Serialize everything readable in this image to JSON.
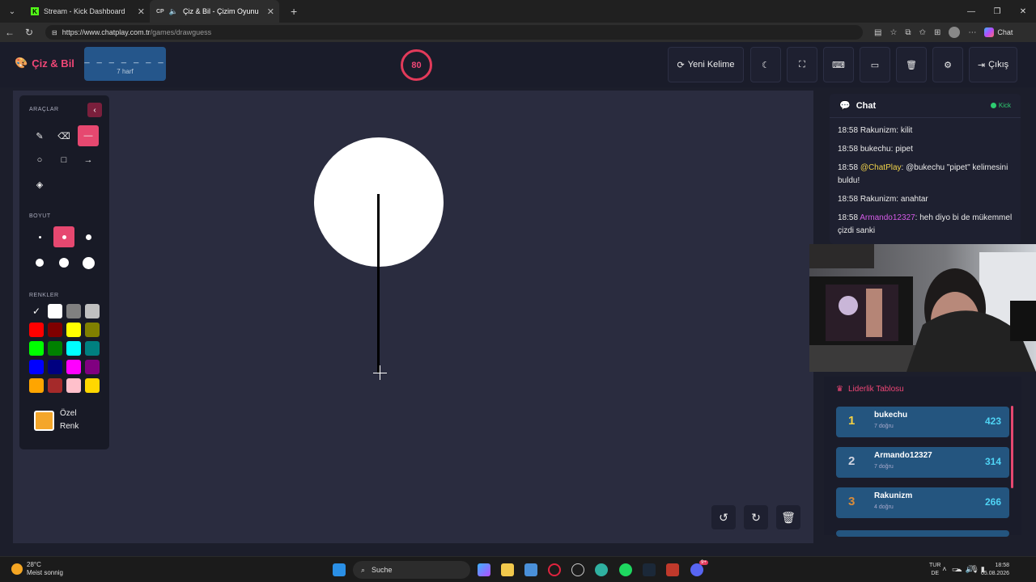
{
  "browser": {
    "tabs": [
      {
        "title": "Stream - Kick Dashboard",
        "favicon": "K"
      },
      {
        "title": "Çiz & Bil - Çizim Oyunu",
        "favicon": "CP"
      }
    ],
    "url_host": "https://www.chatplay.com.tr",
    "url_path": "/games/drawguess",
    "chat_label": "Chat"
  },
  "header": {
    "logo": "Çiz & Bil",
    "word_mask": "_ _ _ _ _ _ _",
    "word_hint": "7 harf",
    "timer": "80",
    "new_word": "Yeni Kelime",
    "logout": "Çıkış"
  },
  "tools": {
    "tools_title": "ARAÇLAR",
    "size_title": "BOYUT",
    "colors_title": "RENKLER",
    "custom_color_label": "Özel Renk",
    "custom_color": "#f4a62a",
    "selected_tool": "line",
    "selected_size": 2,
    "selected_color": "#000000",
    "palette": [
      "#000000",
      "#ffffff",
      "#808080",
      "#c0c0c0",
      "#ff0000",
      "#800000",
      "#ffff00",
      "#808000",
      "#00ff00",
      "#008000",
      "#00ffff",
      "#008080",
      "#0000ff",
      "#000080",
      "#ff00ff",
      "#800080",
      "#ffa500",
      "#a52a2a",
      "#ffc0cb",
      "#ffd700"
    ]
  },
  "chat": {
    "title": "Chat",
    "platform": "Kick",
    "messages": [
      {
        "time": "18:58",
        "user": "Rakunizm",
        "text": "kilit",
        "style": "normal"
      },
      {
        "time": "18:58",
        "user": "bukechu",
        "text": "pipet",
        "style": "normal"
      },
      {
        "time": "18:58",
        "user": "@ChatPlay",
        "text": "@bukechu \"pipet\" kelimesini buldu!",
        "style": "system"
      },
      {
        "time": "18:58",
        "user": "Rakunizm",
        "text": "anahtar",
        "style": "normal"
      },
      {
        "time": "18:58",
        "user": "Armando12327",
        "text": "heh diyo bi de mükemmel çizdi sanki",
        "style": "pink"
      }
    ]
  },
  "leaderboard": {
    "title": "Liderlik Tablosu",
    "rows": [
      {
        "rank": "1",
        "name": "bukechu",
        "sub": "7 doğru",
        "score": "423",
        "rank_color": "#f5d142"
      },
      {
        "rank": "2",
        "name": "Armando12327",
        "sub": "7 doğru",
        "score": "314",
        "rank_color": "#d0d4e0"
      },
      {
        "rank": "3",
        "name": "Rakunizm",
        "sub": "4 doğru",
        "score": "266",
        "rank_color": "#d98c3a"
      }
    ]
  },
  "taskbar": {
    "temp": "28°C",
    "weather": "Meist sonnig",
    "search": "Suche",
    "lang_top": "TUR",
    "lang_bottom": "DE",
    "time": "18:58",
    "date": "05.08.2026",
    "discord_badge": "9+"
  },
  "colors": {
    "accent": "#e64870",
    "brand": "#ef4676",
    "primary_blue": "#24557f"
  }
}
